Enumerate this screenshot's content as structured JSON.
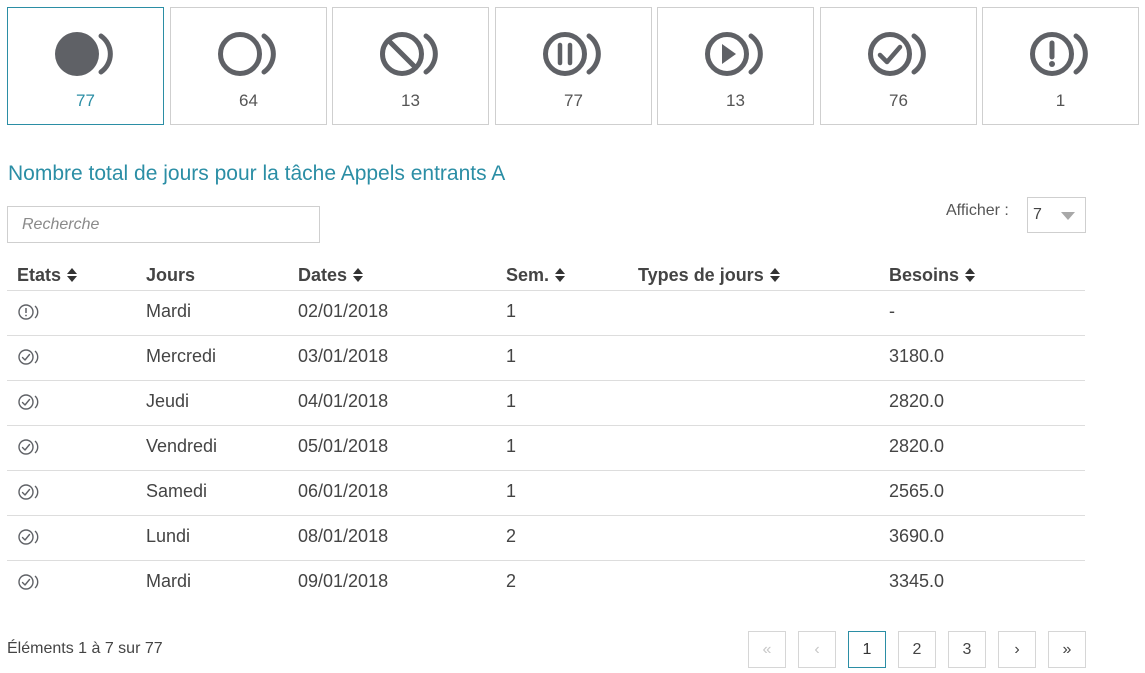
{
  "status_cards": [
    {
      "icon": "filled-circle-icon",
      "count": "77",
      "active": true
    },
    {
      "icon": "empty-circle-icon",
      "count": "64",
      "active": false
    },
    {
      "icon": "blocked-circle-icon",
      "count": "13",
      "active": false
    },
    {
      "icon": "pause-circle-icon",
      "count": "77",
      "active": false
    },
    {
      "icon": "play-circle-icon",
      "count": "13",
      "active": false
    },
    {
      "icon": "check-circle-icon",
      "count": "76",
      "active": false
    },
    {
      "icon": "exclamation-circle-icon",
      "count": "1",
      "active": false
    }
  ],
  "section_title": "Nombre total de jours pour la tâche Appels entrants A",
  "search": {
    "placeholder": "Recherche",
    "value": ""
  },
  "page_size": {
    "label": "Afficher :",
    "value": "7"
  },
  "table": {
    "headers": {
      "etats": "Etats",
      "jours": "Jours",
      "dates": "Dates",
      "sem": "Sem.",
      "types": "Types de jours",
      "besoins": "Besoins"
    },
    "rows": [
      {
        "state": "exclamation-circle-icon",
        "jour": "Mardi",
        "date": "02/01/2018",
        "sem": "1",
        "type": "",
        "besoins": "-"
      },
      {
        "state": "check-circle-icon",
        "jour": "Mercredi",
        "date": "03/01/2018",
        "sem": "1",
        "type": "",
        "besoins": "3180.0"
      },
      {
        "state": "check-circle-icon",
        "jour": "Jeudi",
        "date": "04/01/2018",
        "sem": "1",
        "type": "",
        "besoins": "2820.0"
      },
      {
        "state": "check-circle-icon",
        "jour": "Vendredi",
        "date": "05/01/2018",
        "sem": "1",
        "type": "",
        "besoins": "2820.0"
      },
      {
        "state": "check-circle-icon",
        "jour": "Samedi",
        "date": "06/01/2018",
        "sem": "1",
        "type": "",
        "besoins": "2565.0"
      },
      {
        "state": "check-circle-icon",
        "jour": "Lundi",
        "date": "08/01/2018",
        "sem": "2",
        "type": "",
        "besoins": "3690.0"
      },
      {
        "state": "check-circle-icon",
        "jour": "Mardi",
        "date": "09/01/2018",
        "sem": "2",
        "type": "",
        "besoins": "3345.0"
      }
    ]
  },
  "footer": {
    "info": "Éléments 1 à 7 sur 77"
  },
  "pagination": {
    "first": "«",
    "prev": "‹",
    "pages": [
      "1",
      "2",
      "3"
    ],
    "current": "1",
    "next": "›",
    "last": "»"
  },
  "colors": {
    "accent": "#2b8ea5",
    "icon": "#5f6166",
    "text": "#444444",
    "border": "#cfcfcf"
  }
}
